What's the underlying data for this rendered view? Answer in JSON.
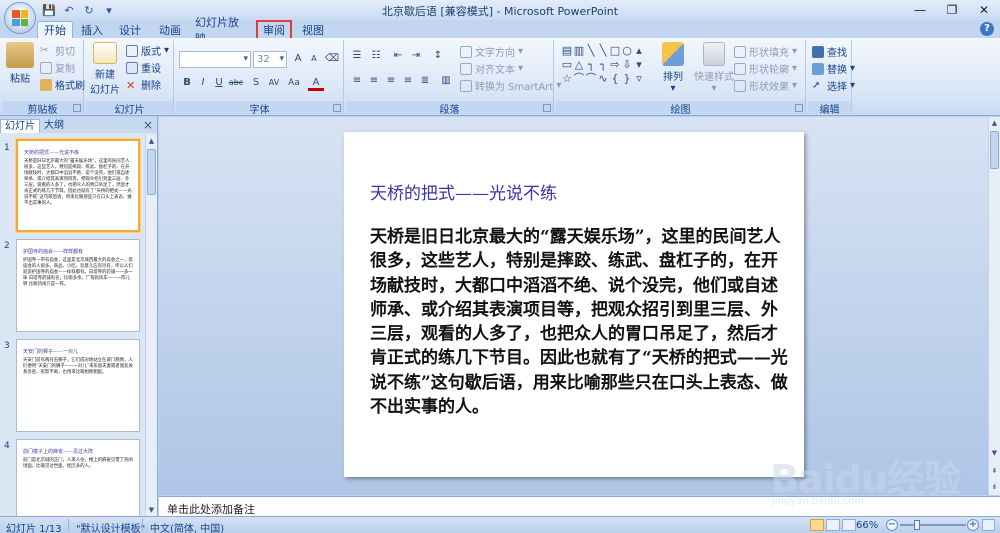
{
  "window": {
    "title": "北京歇后语 [兼容模式] - Microsoft PowerPoint",
    "controls": [
      "minimize",
      "restore",
      "close"
    ]
  },
  "tabs": [
    {
      "label": "开始",
      "active": true
    },
    {
      "label": "插入"
    },
    {
      "label": "设计"
    },
    {
      "label": "动画"
    },
    {
      "label": "幻灯片放映"
    },
    {
      "label": "审阅",
      "highlighted": true
    },
    {
      "label": "视图"
    }
  ],
  "ribbon": {
    "clipboard": {
      "label": "剪贴板",
      "paste": "粘贴",
      "cut": "剪切",
      "copy": "复制",
      "format_painter": "格式刷"
    },
    "slides": {
      "label": "幻灯片",
      "new_slide": "新建",
      "new_slide2": "幻灯片",
      "layout": "版式",
      "reset": "重设",
      "delete": "删除"
    },
    "font": {
      "label": "字体",
      "font_size": "32",
      "bold": "B",
      "italic": "I",
      "underline": "U",
      "strike": "abc",
      "shadow": "S",
      "spacing": "AV",
      "case": "Aa",
      "color": "A",
      "grow": "A",
      "shrink": "A"
    },
    "paragraph": {
      "label": "段落",
      "text_direction": "文字方向",
      "align_text": "对齐文本",
      "smartart": "转换为 SmartArt"
    },
    "drawing": {
      "label": "绘图",
      "arrange": "排列",
      "quick_styles": "快速样式",
      "fill": "形状填充",
      "outline": "形状轮廓",
      "effects": "形状效果"
    },
    "editing": {
      "label": "编辑",
      "find": "查找",
      "replace": "替换",
      "select": "选择"
    }
  },
  "panel": {
    "tab_slides": "幻灯片",
    "tab_outline": "大纲",
    "close": "×",
    "thumbnails": [
      {
        "num": "1",
        "title": "天桥的把式——光说不练",
        "body": "天桥是旧日北京最大的“露天娱乐场”，这里的民间艺人很多，这些艺人，特别是摔跤、练武、盘杠子的，在开场献技时，大都口中滔滔不绝、说个没完，他们或自述师承、或介绍其表演项目等，把观众招引到里三层、外三层，观看的人多了，也把众人的胃口吊足了，然后才肯正式的练几下节目。因此也就有了“天桥的把式——光说不练”这句歇后语，用来比喻那些只在口头上表态、做不出实事的人。"
      },
      {
        "num": "2",
        "title": "护国寺的庙会——样样都有",
        "body": "护国寺一带有庙会，这里是北京城西最大的庙会之一，逛庙会的人很多，商品、小吃、玩意儿应有尽有，所以人们就说护国寺的庙会——样样都有。白塔寺的药铺——多一味 白塔寺药铺有名，比喻多余。厂甸的风车——一阵儿转 比喻热闹只是一阵。"
      },
      {
        "num": "3",
        "title": "天安门的狮子——一对儿",
        "body": "天安门前有两对石狮子，它们成对地站立在城门两侧，人们便用“天安门的狮子——一对儿”来形容夫妻或者朋友关系亲密、形影不离，也用来比喻相称相配。"
      },
      {
        "num": "4",
        "title": "前门楼子上的麻雀——见过大阵",
        "body": "前门是北京城的正门，人来人往，楼上的麻雀见惯了热闹场面，比喻见过世面、经历多的人。"
      }
    ]
  },
  "slide": {
    "title": "天桥的把式——光说不练",
    "body": "天桥是旧日北京最大的“露天娱乐场”，这里的民间艺人很多，这些艺人，特别是摔跤、练武、盘杠子的，在开场献技时，大都口中滔滔不绝、说个没完，他们或自述师承、或介绍其表演项目等，把观众招引到里三层、外三层，观看的人多了，也把众人的胃口吊足了，然后才肯正式的练几下节目。因此也就有了“天桥的把式——光说不练”这句歇后语，用来比喻那些只在口头上表态、做不出实事的人。"
  },
  "notes": {
    "placeholder": "单击此处添加备注"
  },
  "status": {
    "slide_counter": "幻灯片 1/13",
    "theme": "\"默认设计模板\"",
    "language": "中文(简体, 中国)",
    "zoom": "66%"
  },
  "watermark": {
    "brand": "Baidu经验",
    "url": "jingyan.baidu.com"
  },
  "colors": {
    "ribbon_blue": "#c2d6f0",
    "accent_title": "#3636a0",
    "highlight_red": "#e23b3b",
    "selected_orange": "#f5a83a"
  }
}
